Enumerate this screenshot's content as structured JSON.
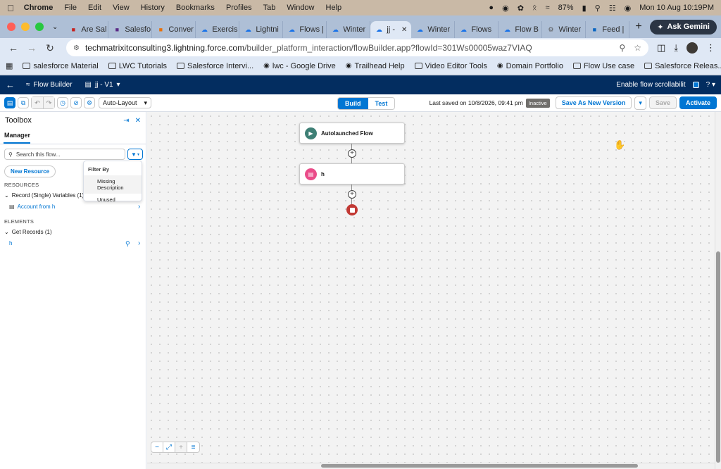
{
  "menubar": {
    "app": "Chrome",
    "items": [
      "File",
      "Edit",
      "View",
      "History",
      "Bookmarks",
      "Profiles",
      "Tab",
      "Window",
      "Help"
    ],
    "battery": "87%",
    "datetime": "Mon 10 Aug  10:19PM"
  },
  "browser": {
    "tabs": [
      {
        "label": "Are Sal",
        "icon": "gmail-icon",
        "color": "#c5221f"
      },
      {
        "label": "Salesfo",
        "icon": "app-icon",
        "color": "#5b2a86"
      },
      {
        "label": "Conver",
        "icon": "converter-icon",
        "color": "#e8710a"
      },
      {
        "label": "Exercis",
        "icon": "cloud-icon",
        "color": "#1a73e8"
      },
      {
        "label": "Lightni",
        "icon": "cloud-icon",
        "color": "#1a73e8"
      },
      {
        "label": "Flows |",
        "icon": "cloud-icon",
        "color": "#1a73e8"
      },
      {
        "label": "Winter",
        "icon": "cloud-icon",
        "color": "#1a73e8"
      },
      {
        "label": "jj -",
        "icon": "cloud-icon",
        "color": "#1a73e8"
      },
      {
        "label": "Winter",
        "icon": "cloud-icon",
        "color": "#1a73e8"
      },
      {
        "label": "Flows",
        "icon": "cloud-icon",
        "color": "#1a73e8"
      },
      {
        "label": "Flow B",
        "icon": "cloud-icon",
        "color": "#1a73e8"
      },
      {
        "label": "Winter",
        "icon": "gear-icon",
        "color": "#555555"
      },
      {
        "label": "Feed |",
        "icon": "linkedin-icon",
        "color": "#0a66c2"
      }
    ],
    "active_tab_index": 7,
    "ask_gemini": "Ask Gemini",
    "url_domain": "techmatrixitconsulting3.lightning.force.com",
    "url_path": "/builder_platform_interaction/flowBuilder.app?flowId=301Ws00005waz7VIAQ",
    "bookmarks": [
      {
        "label": "salesforce Material",
        "icon": "folder-icon"
      },
      {
        "label": "LWC Tutorials",
        "icon": "folder-icon"
      },
      {
        "label": "Salesforce Intervi...",
        "icon": "folder-icon"
      },
      {
        "label": "lwc - Google Drive",
        "icon": "drive-icon"
      },
      {
        "label": "Trailhead Help",
        "icon": "trailhead-icon"
      },
      {
        "label": "Video Editor Tools",
        "icon": "folder-icon"
      },
      {
        "label": "Domain Portfolio",
        "icon": "domain-icon"
      },
      {
        "label": "Flow Use case",
        "icon": "folder-icon"
      },
      {
        "label": "Salesforce Releas...",
        "icon": "folder-icon"
      }
    ]
  },
  "sf_header": {
    "app_label": "Flow Builder",
    "flow_label": "jj - V1",
    "scroll_toggle": "Enable flow scrollabilit",
    "help": "?"
  },
  "toolbar": {
    "layout_select": "Auto-Layout",
    "mode_build": "Build",
    "mode_test": "Test",
    "last_saved": "Last saved on 10/8/2026, 09:41 pm",
    "status_badge": "Inactive",
    "save_new_version": "Save As New Version",
    "save": "Save",
    "activate": "Activate"
  },
  "toolbox": {
    "title": "Toolbox",
    "tab": "Manager",
    "search_placeholder": "Search this flow...",
    "new_resource": "New Resource",
    "resources_label": "RESOURCES",
    "resource_group": "Record (Single) Variables (1)",
    "resource_item": "Account from h",
    "elements_label": "ELEMENTS",
    "element_group": "Get Records (1)",
    "element_item": "h",
    "filter_menu": {
      "header": "Filter By",
      "options": [
        "Missing Description",
        "Unused"
      ]
    }
  },
  "canvas": {
    "start_node": "Autolaunched Flow",
    "get_records_node": "h"
  },
  "colors": {
    "sf_navy": "#032d60",
    "brand_blue": "#0176d3",
    "start_green": "#3e7f75",
    "get_records_pink": "#ea4c89",
    "end_red": "#c23934"
  }
}
